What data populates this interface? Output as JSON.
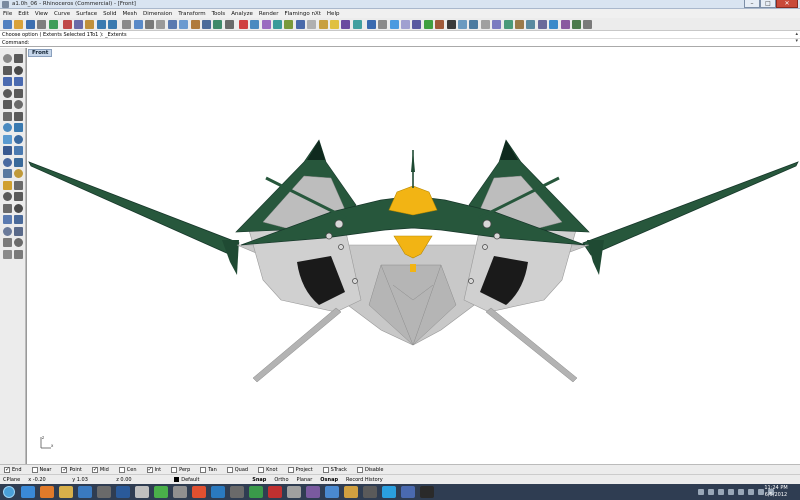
{
  "window": {
    "title": "a1.0h_06 - Rhinoceros (Commercial) - [Front]",
    "minimize": "–",
    "maximize": "□",
    "close": "✕"
  },
  "menu": [
    "File",
    "Edit",
    "View",
    "Curve",
    "Surface",
    "Solid",
    "Mesh",
    "Dimension",
    "Transform",
    "Tools",
    "Analyze",
    "Render",
    "Flamingo nXt",
    "Help"
  ],
  "command": {
    "history": "Choose option ( Extents  Selected  1To1 ): _Extents",
    "prompt": "Command:"
  },
  "viewport": {
    "tab_label": "Front",
    "axis_x": "x",
    "axis_z": "z"
  },
  "osnaps": [
    {
      "label": "End",
      "checked": true
    },
    {
      "label": "Near",
      "checked": false
    },
    {
      "label": "Point",
      "checked": true
    },
    {
      "label": "Mid",
      "checked": true
    },
    {
      "label": "Cen",
      "checked": false
    },
    {
      "label": "Int",
      "checked": true
    },
    {
      "label": "Perp",
      "checked": false
    },
    {
      "label": "Tan",
      "checked": false
    },
    {
      "label": "Quad",
      "checked": false
    },
    {
      "label": "Knot",
      "checked": false
    },
    {
      "label": "Project",
      "checked": false
    },
    {
      "label": "STrack",
      "checked": false
    },
    {
      "label": "Disable",
      "checked": false
    }
  ],
  "status": {
    "cplane": "CPlane",
    "x": "x -0.20",
    "y": "y 1.03",
    "z": "z 0.00",
    "layer": "Default",
    "snap": "Snap",
    "ortho": "Ortho",
    "planar": "Planar",
    "osnap": "Osnap",
    "record_history": "Record History"
  },
  "clock": {
    "time": "11:24 PM",
    "date": "6/5/2012"
  },
  "colors": {
    "model_green": "#27573c",
    "model_gold": "#f2b414",
    "model_gray": "#c9c9c9",
    "viewport_tab": "#c6d6ea",
    "taskbar": "#2f3d52"
  }
}
